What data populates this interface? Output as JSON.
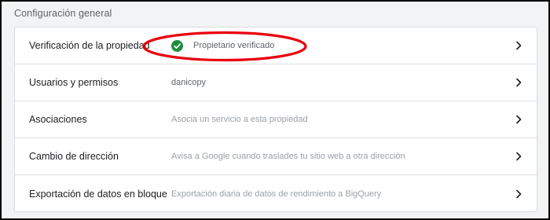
{
  "section": {
    "title": "Configuración general"
  },
  "rows": [
    {
      "label": "Verificación de la propiedad",
      "value": "Propietario verificado",
      "icon": "check-circle-icon",
      "icon_color": "#1e8e3e"
    },
    {
      "label": "Usuarios y permisos",
      "value": "danicopy"
    },
    {
      "label": "Asociaciones",
      "value": "Asocia un servicio a esta propiedad"
    },
    {
      "label": "Cambio de dirección",
      "value": "Avisa a Google cuando traslades tu sitio web a otra dirección"
    },
    {
      "label": "Exportación de datos en bloque",
      "value": "Exportación diaria de datos de rendimiento a BigQuery"
    }
  ],
  "annotation": {
    "shape": "ellipse",
    "color": "#e8000f"
  },
  "colors": {
    "background": "#f1f3f4",
    "card": "#ffffff",
    "divider": "#e0e0e0",
    "label": "#202124",
    "value": "#5f6368",
    "muted": "#9aa0a6"
  }
}
